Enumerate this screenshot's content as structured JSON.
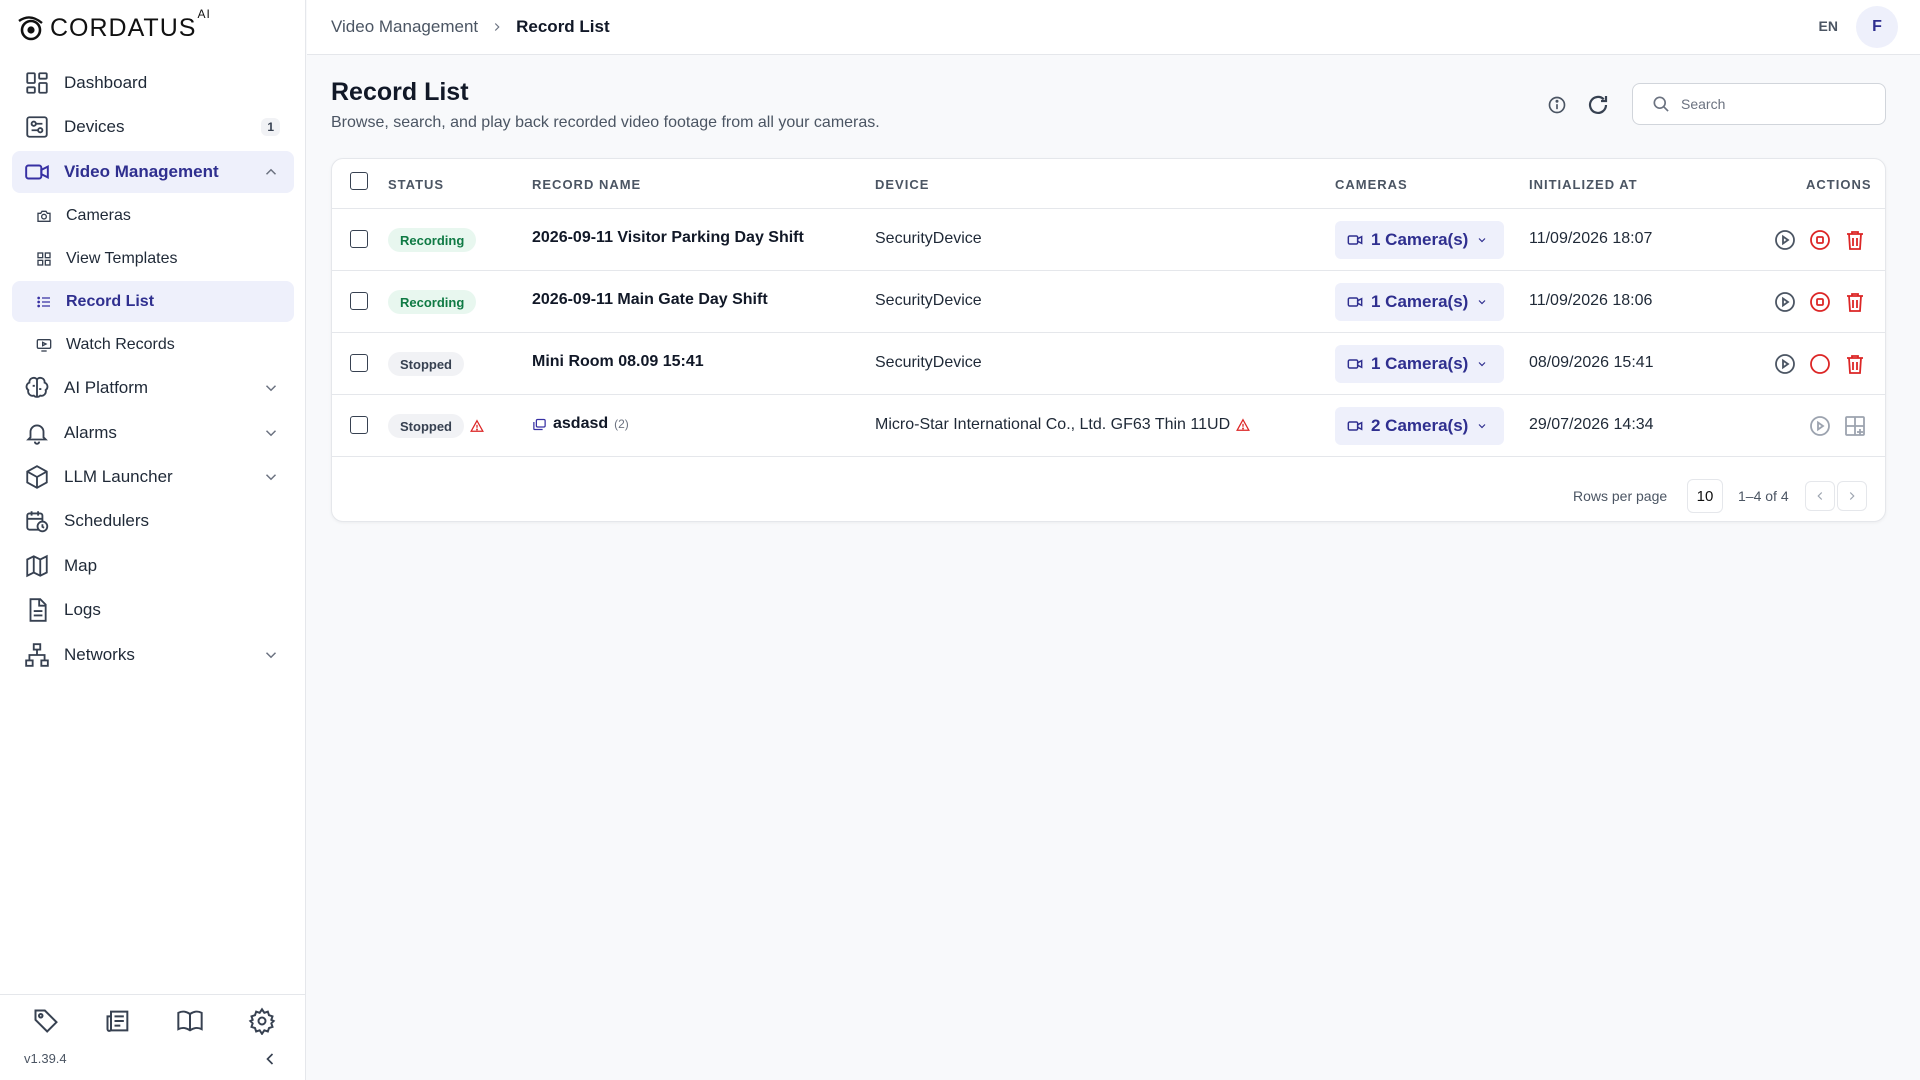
{
  "app": {
    "logo_text": "CORDATUS",
    "logo_sup": "AI"
  },
  "sidebar": {
    "items": [
      {
        "label": "Dashboard",
        "icon": "dashboard-icon"
      },
      {
        "label": "Devices",
        "icon": "devices-icon",
        "badge": "1"
      },
      {
        "label": "Video Management",
        "icon": "video-camera-icon",
        "expanded": true
      },
      {
        "label": "AI Platform",
        "icon": "brain-icon"
      },
      {
        "label": "Alarms",
        "icon": "bell-icon"
      },
      {
        "label": "LLM Launcher",
        "icon": "cube-icon"
      },
      {
        "label": "Schedulers",
        "icon": "calendar-clock-icon"
      },
      {
        "label": "Map",
        "icon": "map-icon"
      },
      {
        "label": "Logs",
        "icon": "document-icon"
      },
      {
        "label": "Networks",
        "icon": "network-icon"
      }
    ],
    "sub_items": [
      {
        "label": "Cameras",
        "icon": "camera-icon"
      },
      {
        "label": "View Templates",
        "icon": "grid-icon"
      },
      {
        "label": "Record List",
        "icon": "list-icon",
        "active": true
      },
      {
        "label": "Watch Records",
        "icon": "monitor-play-icon"
      }
    ],
    "footer": {
      "version": "v1.39.4"
    }
  },
  "header": {
    "breadcrumb_parent": "Video Management",
    "breadcrumb_current": "Record List",
    "lang": "EN",
    "avatar_initial": "F"
  },
  "main": {
    "title": "Record List",
    "subtitle": "Browse, search, and play back recorded video footage from all your cameras.",
    "search_placeholder": "Search"
  },
  "table": {
    "headers": {
      "status": "STATUS",
      "record_name": "RECORD NAME",
      "device": "DEVICE",
      "cameras": "CAMERAS",
      "initialized_at": "INITIALIZED AT",
      "actions": "ACTIONS"
    },
    "rows": [
      {
        "status": "Recording",
        "name": "2026-09-11 Visitor Parking Day Shift",
        "device": "SecurityDevice",
        "cameras": "1 Camera(s)",
        "initialized": "11/09/2026 18:07"
      },
      {
        "status": "Recording",
        "name": "2026-09-11 Main Gate Day Shift",
        "device": "SecurityDevice",
        "cameras": "1 Camera(s)",
        "initialized": "11/09/2026 18:06"
      },
      {
        "status": "Stopped",
        "name": "Mini Room 08.09 15:41",
        "device": "SecurityDevice",
        "cameras": "1 Camera(s)",
        "initialized": "08/09/2026 15:41"
      },
      {
        "status": "Stopped",
        "name": "asdasd",
        "name_count": "(2)",
        "device": "Micro-Star International Co., Ltd. GF63 Thin 11UD",
        "cameras": "2 Camera(s)",
        "initialized": "29/07/2026 14:34"
      }
    ],
    "pager": {
      "rows_per_page_label": "Rows per page",
      "rows_per_page": "10",
      "range": "1–4 of 4"
    }
  },
  "colors": {
    "accent": "#2f2f8f",
    "accent_bg": "#eef0fb",
    "recording": "#0f7a44",
    "danger": "#dc2626"
  }
}
